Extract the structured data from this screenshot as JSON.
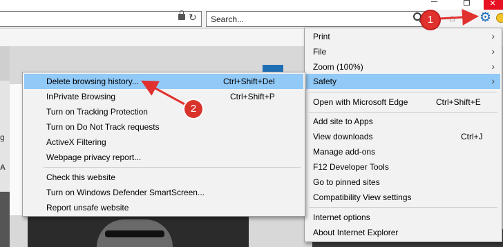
{
  "window": {
    "close_glyph": "×"
  },
  "toolbar": {
    "search_placeholder": "Search...",
    "home_icon": "home-icon",
    "favorites_icon": "star-icon",
    "tools_icon": "gear-icon"
  },
  "page": {
    "partial_text_1": "g",
    "partial_text_2": "A"
  },
  "main_menu": {
    "items": [
      {
        "label": "Print",
        "submenu": true
      },
      {
        "label": "File",
        "submenu": true
      },
      {
        "label": "Zoom (100%)",
        "submenu": true
      },
      {
        "label": "Safety",
        "submenu": true,
        "highlighted": true
      },
      {
        "label": "Open with Microsoft Edge",
        "shortcut": "Ctrl+Shift+E"
      },
      {
        "label": "Add site to Apps"
      },
      {
        "label": "View downloads",
        "shortcut": "Ctrl+J"
      },
      {
        "label": "Manage add-ons"
      },
      {
        "label": "F12 Developer Tools"
      },
      {
        "label": "Go to pinned sites"
      },
      {
        "label": "Compatibility View settings"
      },
      {
        "label": "Internet options"
      },
      {
        "label": "About Internet Explorer"
      }
    ]
  },
  "safety_menu": {
    "items": [
      {
        "label": "Delete browsing history...",
        "shortcut": "Ctrl+Shift+Del",
        "highlighted": true
      },
      {
        "label": "InPrivate Browsing",
        "shortcut": "Ctrl+Shift+P"
      },
      {
        "label": "Turn on Tracking Protection"
      },
      {
        "label": "Turn on Do Not Track requests"
      },
      {
        "label": "ActiveX Filtering"
      },
      {
        "label": "Webpage privacy report..."
      },
      {
        "label": "Check this website"
      },
      {
        "label": "Turn on Windows Defender SmartScreen..."
      },
      {
        "label": "Report unsafe website"
      }
    ]
  },
  "annotations": {
    "step_1": "1",
    "step_2": "2",
    "color": "#e0312f"
  },
  "colors": {
    "highlight": "#91c9f7",
    "menu_bg": "#f2f2f2",
    "gear": "#1e6fbf"
  }
}
